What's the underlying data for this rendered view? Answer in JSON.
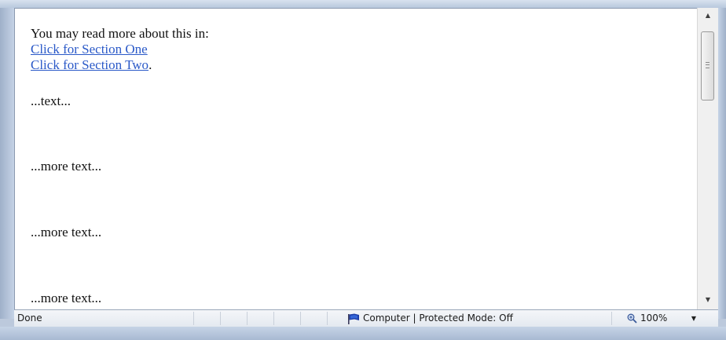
{
  "content": {
    "intro_text": "You may read more about this in:",
    "link_one": "Click for Section One",
    "link_two": "Click for Section Two",
    "link_two_suffix": ".",
    "paragraphs": [
      "...text...",
      "...more text...",
      "...more text...",
      "...more text..."
    ]
  },
  "scrollbar": {
    "up_arrow_icon": "scroll-up-arrow",
    "down_arrow_icon": "scroll-down-arrow",
    "position_fraction": 0.0
  },
  "status_bar": {
    "status": "Done",
    "zone_icon": "flag-icon",
    "zone": "Computer | Protected Mode: Off",
    "zoom_icon": "magnifier-icon",
    "zoom": "100%"
  },
  "colors": {
    "link": "#2a59c8",
    "frame": "#bcc9dc",
    "statusbar": "#e9edf3"
  }
}
